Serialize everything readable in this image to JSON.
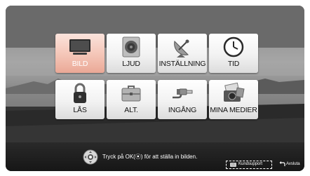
{
  "menu": {
    "tiles": [
      {
        "label": "BILD",
        "icon": "tv-icon",
        "selected": true
      },
      {
        "label": "LJUD",
        "icon": "speaker-icon",
        "selected": false
      },
      {
        "label": "INSTÄLLNING",
        "icon": "satellite-dish-icon",
        "selected": false
      },
      {
        "label": "TID",
        "icon": "clock-icon",
        "selected": false
      },
      {
        "label": "LÅS",
        "icon": "padlock-icon",
        "selected": false
      },
      {
        "label": "ALT.",
        "icon": "toolbox-icon",
        "selected": false
      },
      {
        "label": "INGÅNG",
        "icon": "cable-plug-icon",
        "selected": false
      },
      {
        "label": "MINA MEDIER",
        "icon": "media-camera-icon",
        "selected": false
      }
    ]
  },
  "footer": {
    "hint": "Tryck på OK(⦿) för att ställa in bilden.",
    "support_badge": "ⓡ",
    "support_label": "Kundsupport",
    "exit_label": "Avsluta"
  },
  "colors": {
    "selected_tile": "#f0b5a4",
    "tile": "#f2f2f2",
    "background": "#7a7a7a"
  }
}
